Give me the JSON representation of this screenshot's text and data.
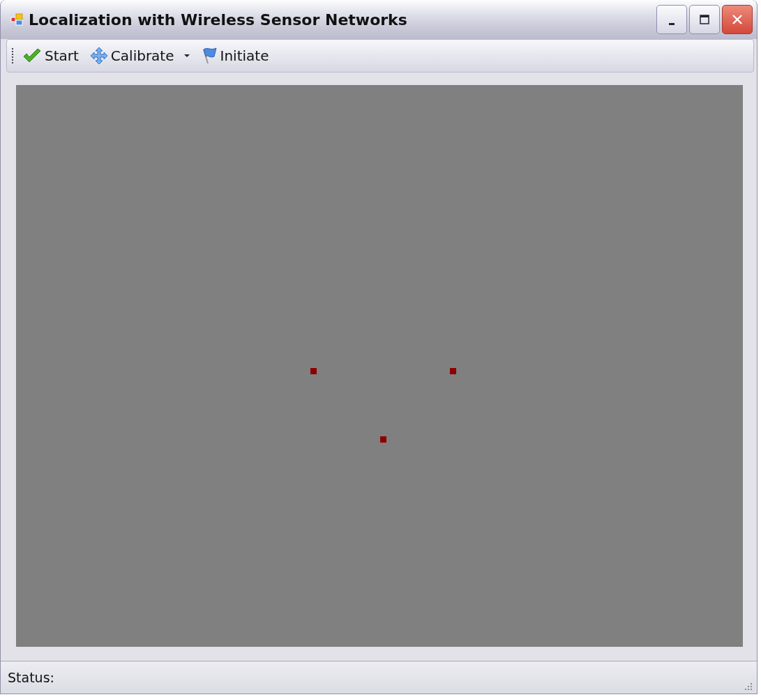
{
  "window": {
    "title": "Localization with Wireless Sensor Networks"
  },
  "toolbar": {
    "items": [
      {
        "label": "Start",
        "kind": "check"
      },
      {
        "label": "Calibrate",
        "kind": "move",
        "dropdown": true
      },
      {
        "label": "Initiate",
        "kind": "flag"
      }
    ]
  },
  "canvas": {
    "nodes": [
      {
        "kind": "sensor"
      },
      {
        "kind": "sensor"
      },
      {
        "kind": "sensor"
      }
    ]
  },
  "status_bar": {
    "label": "Status:"
  }
}
